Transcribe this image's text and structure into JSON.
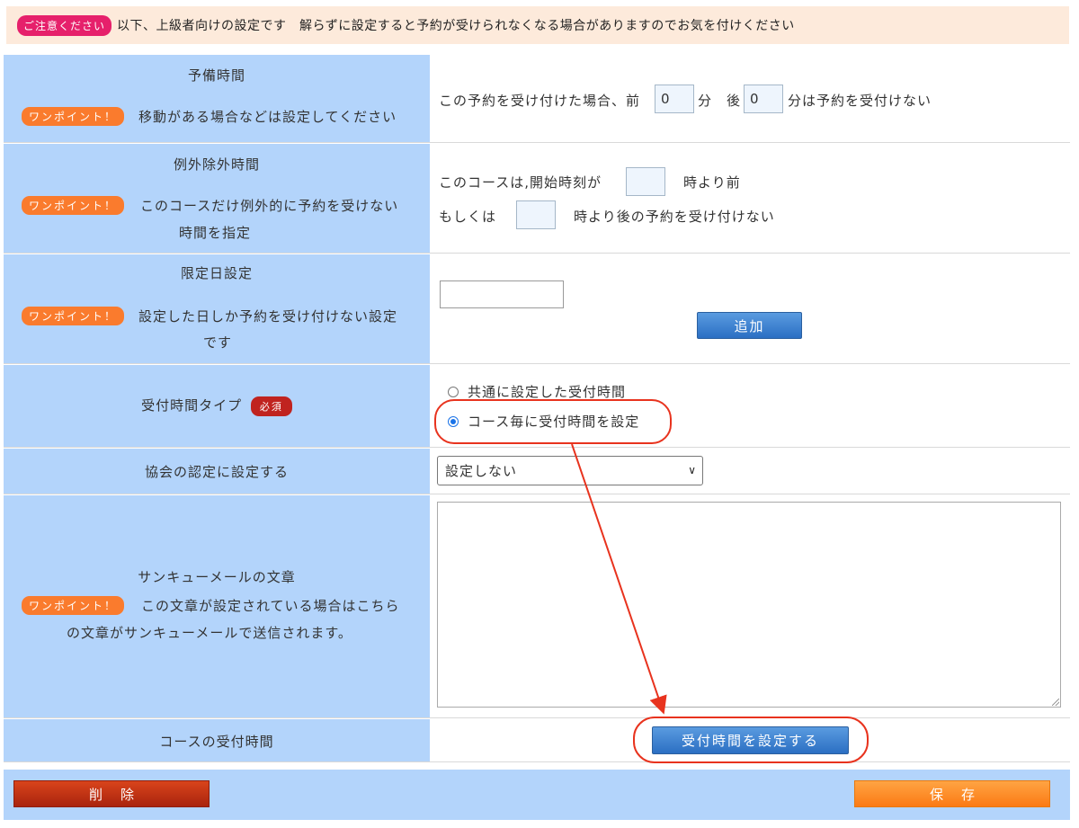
{
  "notice": {
    "badge": "ご注意ください",
    "text": "以下、上級者向けの設定です　解らずに設定すると予約が受けられなくなる場合がありますのでお気を付けください"
  },
  "hint_badge": "ワンポイント！",
  "required_badge": "必須",
  "buffer_time": {
    "label": "予備時間",
    "hint": "移動がある場合などは設定してください",
    "text_before": "この予約を受け付けた場合、前",
    "before_value": "0",
    "unit_min": "分",
    "text_after": "後",
    "after_value": "0",
    "text_end": "分は予約を受付けない"
  },
  "exclusion_time": {
    "label": "例外除外時間",
    "hint_line1": "このコースだけ例外的に予約を受けない",
    "hint_line2": "時間を指定",
    "line1_prefix": "このコースは,開始時刻が",
    "line1_suffix": "時より前",
    "line2_prefix": "もしくは",
    "line2_suffix": "時より後の予約を受け付けない",
    "start_value": "",
    "end_value": ""
  },
  "limited_day": {
    "label": "限定日設定",
    "hint_line1": "設定した日しか予約を受け付けない設定",
    "hint_line2": "です",
    "date_value": "",
    "add_button": "追加"
  },
  "reception_type": {
    "label": "受付時間タイプ",
    "options": [
      "共通に設定した受付時間",
      "コース毎に受付時間を設定"
    ],
    "selected_index": 1
  },
  "association": {
    "label": "協会の認定に設定する",
    "selected": "設定しない"
  },
  "thankyou_mail": {
    "label": "サンキューメールの文章",
    "hint_line1": "この文章が設定されている場合はこちら",
    "hint_line2": "の文章がサンキューメールで送信されます。",
    "body": ""
  },
  "course_reception": {
    "label": "コースの受付時間",
    "button": "受付時間を設定する"
  },
  "footer": {
    "delete": "削除",
    "save": "保存"
  },
  "colors": {
    "label_bg": "#b3d4fb",
    "notice_bg": "#fdeadb",
    "annotation": "#e8331e"
  }
}
